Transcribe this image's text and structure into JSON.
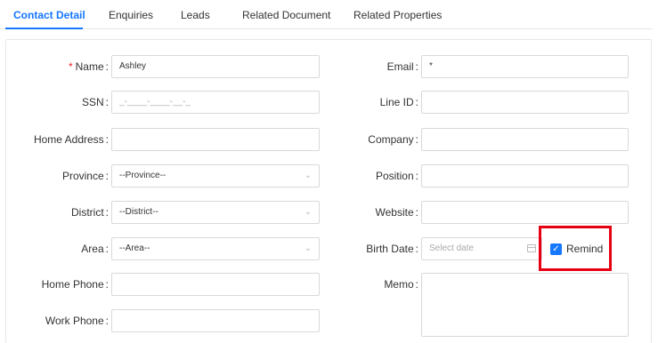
{
  "tabs": [
    {
      "label": "Contact Detail",
      "active": true
    },
    {
      "label": "Enquiries"
    },
    {
      "label": "Leads"
    },
    {
      "label": "Related Document"
    },
    {
      "label": "Related Properties"
    }
  ],
  "left": {
    "name": {
      "label": "Name",
      "value": "Ashley",
      "required": true
    },
    "ssn": {
      "label": "SSN",
      "placeholder": "_-____-____-__-_"
    },
    "home_address": {
      "label": "Home Address",
      "value": ""
    },
    "province": {
      "label": "Province",
      "value": "--Province--"
    },
    "district": {
      "label": "District",
      "value": "--District--"
    },
    "area": {
      "label": "Area",
      "value": "--Area--"
    },
    "home_phone": {
      "label": "Home Phone",
      "value": ""
    },
    "work_phone": {
      "label": "Work Phone",
      "value": ""
    }
  },
  "right": {
    "email": {
      "label": "Email",
      "value": "*"
    },
    "line_id": {
      "label": "Line ID",
      "value": ""
    },
    "company": {
      "label": "Company",
      "value": ""
    },
    "position": {
      "label": "Position",
      "value": ""
    },
    "website": {
      "label": "Website",
      "value": ""
    },
    "birth_date": {
      "label": "Birth Date",
      "placeholder": "Select date"
    },
    "remind": {
      "label": "Remind",
      "checked": true
    },
    "memo": {
      "label": "Memo",
      "value": ""
    }
  },
  "colon": ":",
  "required_mark": "*",
  "accent_color": "#1677ff",
  "highlight_color": "#e60012"
}
